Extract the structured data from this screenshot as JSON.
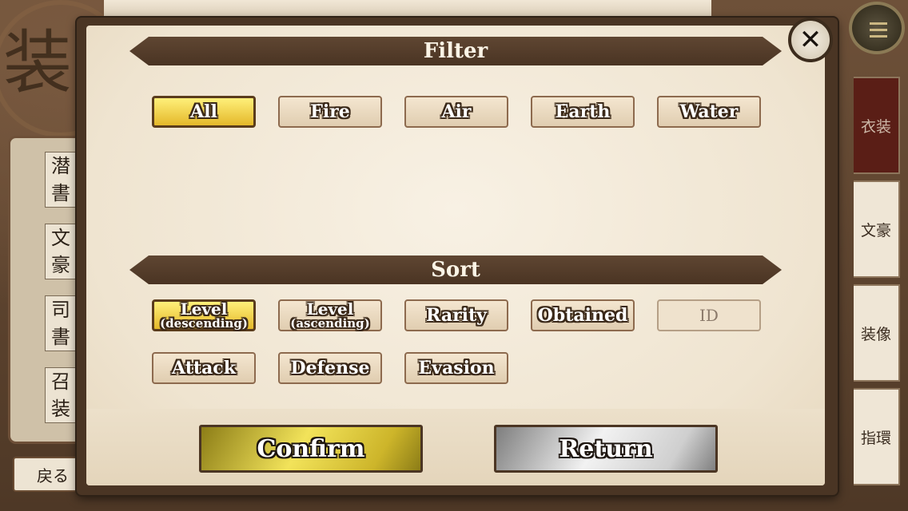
{
  "background": {
    "big_kanji": "装",
    "side_books": [
      {
        "top": "潜",
        "bottom": "書"
      },
      {
        "top": "文",
        "bottom": "豪"
      },
      {
        "top": "司",
        "bottom": "書"
      },
      {
        "top": "召",
        "bottom": "装"
      }
    ],
    "back_label": "戻る",
    "right_tabs": [
      "衣装",
      "文豪",
      "装像",
      "指環"
    ]
  },
  "dialog": {
    "filter_title": "Filter",
    "filter_options": [
      "All",
      "Fire",
      "Air",
      "Earth",
      "Water"
    ],
    "filter_selected": "All",
    "sort_title": "Sort",
    "sort_options": {
      "level_desc": {
        "label": "Level",
        "sub": "(descending)"
      },
      "level_asc": {
        "label": "Level",
        "sub": "(ascending)"
      },
      "rarity": "Rarity",
      "obtained": "Obtained",
      "id": "ID",
      "attack": "Attack",
      "defense": "Defense",
      "evasion": "Evasion"
    },
    "sort_selected": "Level (descending)",
    "confirm_label": "Confirm",
    "return_label": "Return",
    "close_symbol": "✕"
  }
}
